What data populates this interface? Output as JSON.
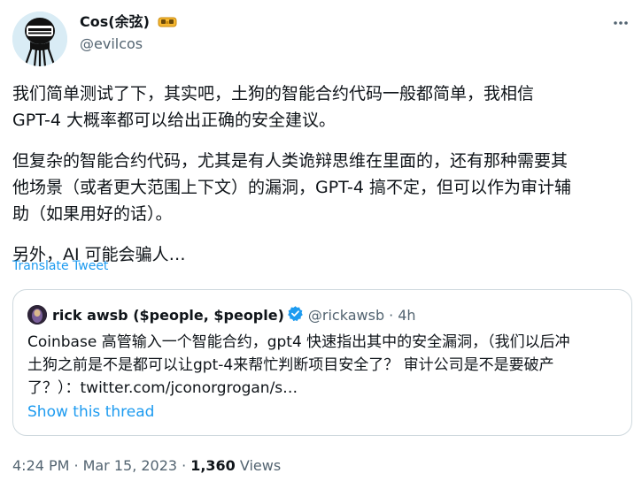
{
  "author": {
    "name": "Cos(余弦)",
    "handle": "@evilcos"
  },
  "tweet": {
    "paragraphs": [
      "我们简单测试了下，其实吧，土狗的智能合约代码一般都简单，我相信\nGPT-4 大概率都可以给出正确的安全建议。",
      "但复杂的智能合约代码，尤其是有人类诡辩思维在里面的，还有那种需要其\n他场景（或者更大范围上下文）的漏洞，GPT-4 搞不定，但可以作为审计辅\n助（如果用好的话）。",
      "另外，AI 可能会骗人…"
    ],
    "translate_label": "Translate Tweet"
  },
  "quote": {
    "name": "rick awsb ($people, $people)",
    "handle": "@rickawsb",
    "dot": "·",
    "time": "4h",
    "text": "Coinbase 高管输入一个智能合约，gpt4 快速指出其中的安全漏洞，（我们以后冲\n土狗之前是不是都可以让gpt-4来帮忙判断项目安全了？ 审计公司是不是要破产\n了？）：twitter.com/jconorgrogan/s…",
    "show_thread_label": "Show this thread"
  },
  "meta": {
    "time": "4:24 PM",
    "sep1": "·",
    "date": "Mar 15, 2023",
    "sep2": "·",
    "views_count": "1,360",
    "views_label": "Views"
  },
  "colors": {
    "link": "#1d9bf0",
    "secondary_text": "#536471",
    "border": "#cfd9de",
    "verified": "#1d9bf0"
  },
  "icons": {
    "author_badge": "vr-headset-icon",
    "more": "more-icon",
    "verified": "verified-badge-icon"
  }
}
